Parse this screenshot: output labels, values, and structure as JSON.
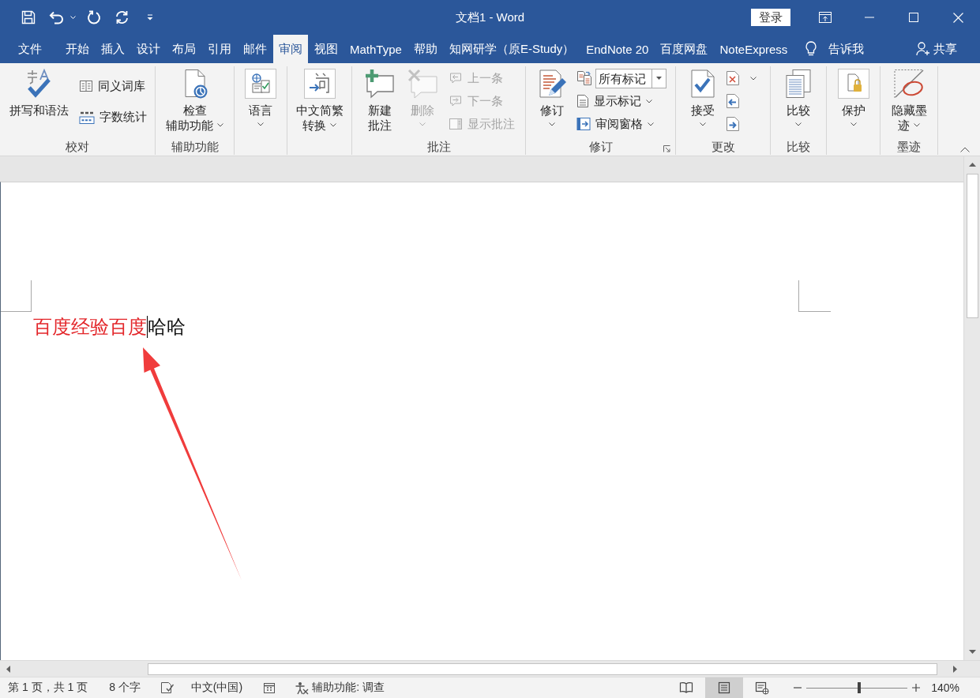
{
  "window": {
    "title": "文档1 - Word",
    "sign_in": "登录"
  },
  "tabs": [
    {
      "label": "文件",
      "selected": false
    },
    {
      "label": "开始",
      "selected": false
    },
    {
      "label": "插入",
      "selected": false
    },
    {
      "label": "设计",
      "selected": false
    },
    {
      "label": "布局",
      "selected": false
    },
    {
      "label": "引用",
      "selected": false
    },
    {
      "label": "邮件",
      "selected": false
    },
    {
      "label": "审阅",
      "selected": true
    },
    {
      "label": "视图",
      "selected": false
    },
    {
      "label": "MathType",
      "selected": false
    },
    {
      "label": "帮助",
      "selected": false
    },
    {
      "label": "知网研学（原E-Study）",
      "selected": false
    },
    {
      "label": "EndNote 20",
      "selected": false
    },
    {
      "label": "百度网盘",
      "selected": false
    },
    {
      "label": "NoteExpress",
      "selected": false
    }
  ],
  "tell_me": "告诉我",
  "share": "共享",
  "ribbon_groups": [
    {
      "label": "校对",
      "controls": [
        {
          "kind": "large",
          "lines": [
            "拼写和语法"
          ],
          "menu": false,
          "disabled": false
        },
        {
          "kind": "small",
          "lines": [
            "同义词库"
          ],
          "menu": false,
          "disabled": false
        },
        {
          "kind": "small",
          "lines": [
            "字数统计"
          ],
          "menu": false,
          "disabled": false
        }
      ]
    },
    {
      "label": "辅助功能",
      "controls": [
        {
          "kind": "large",
          "lines": [
            "检查",
            "辅助功能"
          ],
          "menu": true,
          "disabled": false
        }
      ]
    },
    {
      "controls": [
        {
          "kind": "large",
          "lines": [
            "语言"
          ],
          "menu": true,
          "disabled": false
        }
      ]
    },
    {
      "controls": [
        {
          "kind": "large",
          "lines": [
            "中文简繁",
            "转换"
          ],
          "menu": true,
          "disabled": false
        }
      ]
    },
    {
      "label": "批注",
      "controls": [
        {
          "kind": "large",
          "lines": [
            "新建",
            "批注"
          ],
          "menu": false,
          "disabled": false
        },
        {
          "kind": "large",
          "lines": [
            "删除"
          ],
          "menu": true,
          "disabled": true
        },
        {
          "kind": "small",
          "lines": [
            "上一条"
          ],
          "menu": false,
          "disabled": true
        },
        {
          "kind": "small",
          "lines": [
            "下一条"
          ],
          "menu": false,
          "disabled": true
        },
        {
          "kind": "small",
          "lines": [
            "显示批注"
          ],
          "menu": false,
          "disabled": true
        }
      ]
    },
    {
      "label": "修订",
      "controls": [
        {
          "kind": "large",
          "lines": [
            "修订"
          ],
          "menu": true,
          "disabled": false
        },
        {
          "kind": "combo",
          "value": "所有标记",
          "disabled": false
        },
        {
          "kind": "small",
          "lines": [
            "显示标记"
          ],
          "menu": true,
          "disabled": false
        },
        {
          "kind": "small",
          "lines": [
            "审阅窗格"
          ],
          "menu": true,
          "disabled": false
        }
      ]
    },
    {
      "label": "更改",
      "controls": [
        {
          "kind": "large",
          "lines": [
            "接受"
          ],
          "menu": true,
          "disabled": false
        },
        {
          "kind": "icon",
          "menu": true,
          "disabled": false
        },
        {
          "kind": "icon",
          "menu": false,
          "disabled": false
        },
        {
          "kind": "icon",
          "menu": false,
          "disabled": false
        }
      ]
    },
    {
      "label": "比较",
      "controls": [
        {
          "kind": "large",
          "lines": [
            "比较"
          ],
          "menu": true,
          "disabled": false
        }
      ]
    },
    {
      "controls": [
        {
          "kind": "large",
          "lines": [
            "保护"
          ],
          "menu": true,
          "disabled": false
        }
      ]
    },
    {
      "label": "墨迹",
      "controls": [
        {
          "kind": "large",
          "lines": [
            "隐藏墨",
            "迹"
          ],
          "menu": true,
          "disabled": false
        }
      ]
    }
  ],
  "document": {
    "runs": [
      {
        "text": "百度经验百度",
        "color": "#e3262a",
        "cursor_after": true
      },
      {
        "text": "哈哈",
        "color": "#111111",
        "cursor_after": false
      }
    ]
  },
  "status_bar": {
    "page": "第 1 页，共 1 页",
    "words": "8 个字",
    "language": "中文(中国)",
    "accessibility": "辅助功能: 调查",
    "views": [
      {
        "selected": false
      },
      {
        "selected": true
      },
      {
        "selected": false
      }
    ],
    "zoom": {
      "level": 0.52,
      "reading": "140%"
    }
  }
}
